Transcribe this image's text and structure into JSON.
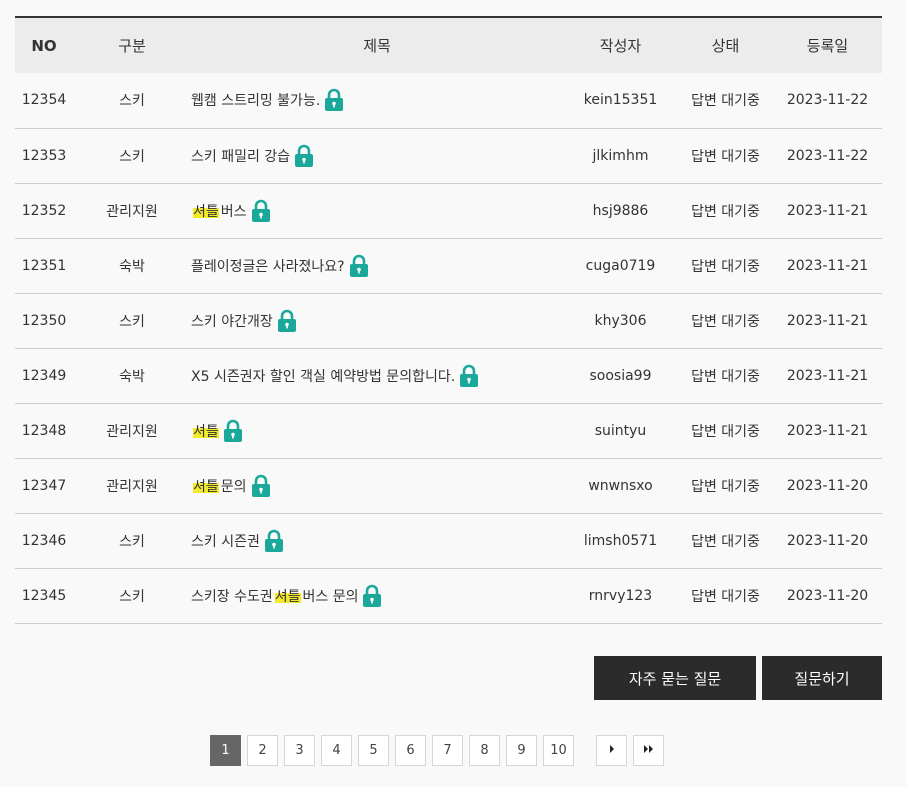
{
  "table": {
    "headers": {
      "no": "NO",
      "category": "구분",
      "title": "제목",
      "author": "작성자",
      "status": "상태",
      "date": "등록일"
    },
    "rows": [
      {
        "no": "12354",
        "category": "스키",
        "title_pre": "웹캠 스트리밍 불가능.",
        "title_hl": "",
        "title_post": "",
        "author": "kein15351",
        "status": "답변 대기중",
        "date": "2023-11-22"
      },
      {
        "no": "12353",
        "category": "스키",
        "title_pre": "스키 패밀리 강습",
        "title_hl": "",
        "title_post": "",
        "author": "jlkimhm",
        "status": "답변 대기중",
        "date": "2023-11-22"
      },
      {
        "no": "12352",
        "category": "관리지원",
        "title_pre": "",
        "title_hl": "셔틀",
        "title_post": "버스",
        "author": "hsj9886",
        "status": "답변 대기중",
        "date": "2023-11-21"
      },
      {
        "no": "12351",
        "category": "숙박",
        "title_pre": "플레이정글은 사라졌나요?",
        "title_hl": "",
        "title_post": "",
        "author": "cuga0719",
        "status": "답변 대기중",
        "date": "2023-11-21"
      },
      {
        "no": "12350",
        "category": "스키",
        "title_pre": "스키 야간개장",
        "title_hl": "",
        "title_post": "",
        "author": "khy306",
        "status": "답변 대기중",
        "date": "2023-11-21"
      },
      {
        "no": "12349",
        "category": "숙박",
        "title_pre": "X5 시즌권자 할인 객실 예약방법 문의합니다.",
        "title_hl": "",
        "title_post": "",
        "author": "soosia99",
        "status": "답변 대기중",
        "date": "2023-11-21"
      },
      {
        "no": "12348",
        "category": "관리지원",
        "title_pre": "",
        "title_hl": "셔틀",
        "title_post": "",
        "author": "suintyu",
        "status": "답변 대기중",
        "date": "2023-11-21"
      },
      {
        "no": "12347",
        "category": "관리지원",
        "title_pre": "",
        "title_hl": "셔틀",
        "title_post": "문의",
        "author": "wnwnsxo",
        "status": "답변 대기중",
        "date": "2023-11-20"
      },
      {
        "no": "12346",
        "category": "스키",
        "title_pre": "스키 시즌권",
        "title_hl": "",
        "title_post": "",
        "author": "limsh0571",
        "status": "답변 대기중",
        "date": "2023-11-20"
      },
      {
        "no": "12345",
        "category": "스키",
        "title_pre": "스키장 수도권 ",
        "title_hl": "셔틀",
        "title_post": " 버스 문의",
        "author": "rnrvy123",
        "status": "답변 대기중",
        "date": "2023-11-20"
      }
    ],
    "lock_icon": "lock-icon",
    "lock_color": "#1aa89a",
    "highlight_color": "#f2ea2a"
  },
  "buttons": {
    "faq": "자주 묻는 질문",
    "ask": "질문하기"
  },
  "pagination": {
    "pages": [
      "1",
      "2",
      "3",
      "4",
      "5",
      "6",
      "7",
      "8",
      "9",
      "10"
    ],
    "current": "1",
    "next_icon": "caret-right-icon",
    "last_icon": "double-caret-right-icon"
  }
}
